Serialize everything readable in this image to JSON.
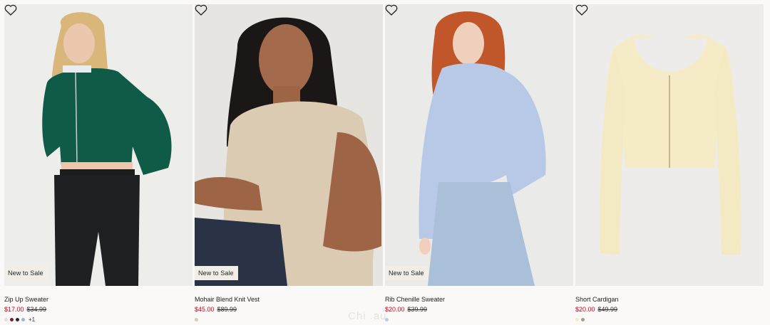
{
  "products": [
    {
      "title": "Zip Up Sweater",
      "price": "$17.00",
      "original_price": "$34.99",
      "badge": "New to Sale",
      "swatches": [
        "#e7ded5",
        "#7b1e2c",
        "#2a2a2a",
        "#9fb5d6"
      ],
      "more_colors": "+1",
      "image": "woman-green-zip-sweater"
    },
    {
      "title": "Mohair Blend Knit Vest",
      "price": "$45.00",
      "original_price": "$89.99",
      "badge": "New to Sale",
      "swatches": [
        "#d8ccb4"
      ],
      "more_colors": "",
      "image": "woman-beige-knit-vest"
    },
    {
      "title": "Rib Chenille Sweater",
      "price": "$20.00",
      "original_price": "$39.99",
      "badge": "New to Sale",
      "swatches": [
        "#b9cbe8"
      ],
      "more_colors": "",
      "image": "woman-light-blue-sweater"
    },
    {
      "title": "Short Cardigan",
      "price": "$20.00",
      "original_price": "$49.99",
      "badge": "",
      "swatches": [
        "#f3ebc6",
        "#9aa58a"
      ],
      "more_colors": "",
      "image": "cream-cardigan-flatlay"
    }
  ],
  "watermark": "Chi   .au",
  "colors": {
    "sale_price": "#d0021b",
    "badge_bg": "#f2eee7",
    "page_bg": "#faf9f8"
  },
  "icons": {
    "favorite": "heart-outline-icon"
  }
}
